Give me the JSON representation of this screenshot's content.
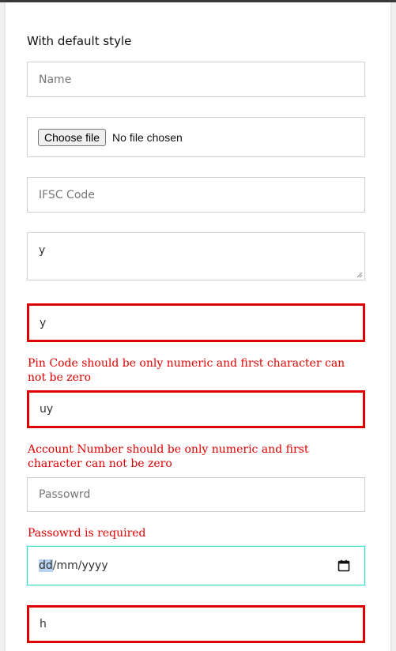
{
  "section_title": "With default style",
  "fields": {
    "name_placeholder": "Name",
    "file_button": "Choose file",
    "file_status": "No file chosen",
    "ifsc_placeholder": "IFSC Code",
    "textarea_value": "y",
    "pincode_value": "y",
    "pincode_error": "Pin Code should be only numeric and first character can not be zero",
    "account_value": "uy",
    "account_error": "Account Number should be only numeric and first character can not be zero",
    "password_placeholder": "Passowrd",
    "password_error": "Passowrd is required",
    "date_day": "dd",
    "date_rest": "/mm/yyyy",
    "last_value": "h"
  },
  "colors": {
    "error": "#e00000",
    "focus": "#2ee0bf",
    "border": "#cfcfcf"
  },
  "icons": {
    "calendar": "calendar-icon"
  }
}
